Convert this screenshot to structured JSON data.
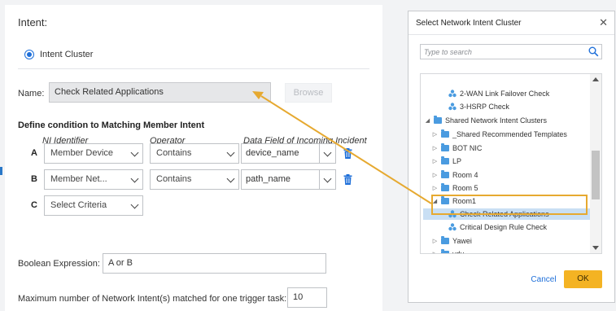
{
  "panel": {
    "title": "Intent:",
    "radio_label": "Intent Cluster",
    "name_label": "Name:",
    "name_value": "Check Related Applications",
    "browse_label": "Browse",
    "section_heading": "Define condition to Matching Member Intent",
    "columns": {
      "identifier": "NI Identifier",
      "operator": "Operator",
      "data_field": "Data Field of Incoming Incident"
    },
    "rows": [
      {
        "letter": "A",
        "identifier": "Member Device",
        "operator": "Contains",
        "field": "device_name"
      },
      {
        "letter": "B",
        "identifier": "Member Net...",
        "operator": "Contains",
        "field": "path_name"
      },
      {
        "letter": "C",
        "identifier": "Select Criteria"
      }
    ],
    "boolean_label": "Boolean Expression:",
    "boolean_value": "A or B",
    "max_label": "Maximum number of Network Intent(s) matched for one trigger task:",
    "max_value": "10"
  },
  "dialog": {
    "title": "Select Network Intent Cluster",
    "close_glyph": "✕",
    "search_placeholder": "Type to search",
    "tree": [
      {
        "label": "2-WAN Link Failover Check",
        "kind": "cluster"
      },
      {
        "label": "3-HSRP Check",
        "kind": "cluster"
      },
      {
        "label": "Shared Network Intent Clusters",
        "kind": "folder",
        "expander": "◢"
      },
      {
        "label": "_Shared Recommended Templates",
        "kind": "folder",
        "expander": "▷"
      },
      {
        "label": "BOT NIC",
        "kind": "folder",
        "expander": "▷"
      },
      {
        "label": "LP",
        "kind": "folder",
        "expander": "▷"
      },
      {
        "label": "Room 4",
        "kind": "folder",
        "expander": "▷"
      },
      {
        "label": "Room 5",
        "kind": "folder",
        "expander": "▷"
      },
      {
        "label": "Room1",
        "kind": "folder",
        "expander": "◢"
      },
      {
        "label": "Check Related Applications",
        "kind": "cluster",
        "selected": true
      },
      {
        "label": "Critical Design Rule Check",
        "kind": "cluster"
      },
      {
        "label": "Yawei",
        "kind": "folder",
        "expander": "▷"
      },
      {
        "label": "ydu",
        "kind": "folder",
        "expander": "▷"
      }
    ],
    "cancel_label": "Cancel",
    "ok_label": "OK"
  },
  "colors": {
    "accent": "#1e6fd9",
    "highlight": "#e6a930",
    "ok_button": "#f4b323",
    "folder": "#4a9be0"
  }
}
